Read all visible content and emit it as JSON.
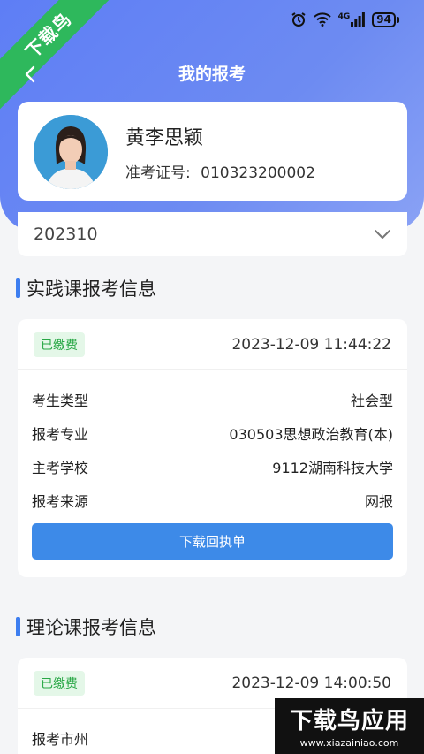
{
  "status_bar": {
    "battery": "94",
    "network": "4G"
  },
  "ribbon": {
    "text": "下载鸟"
  },
  "nav": {
    "title": "我的报考"
  },
  "profile": {
    "name": "黄李思颖",
    "ticket_label": "准考证号:",
    "ticket_number": "010323200002"
  },
  "term": {
    "selected": "202310"
  },
  "practice": {
    "title": "实践课报考信息",
    "badge": "已缴费",
    "time": "2023-12-09 11:44:22",
    "rows": [
      {
        "label": "考生类型",
        "value": "社会型"
      },
      {
        "label": "报考专业",
        "value": "030503思想政治教育(本)"
      },
      {
        "label": "主考学校",
        "value": "9112湖南科技大学"
      },
      {
        "label": "报考来源",
        "value": "网报"
      }
    ],
    "download_label": "下载回执单"
  },
  "theory": {
    "title": "理论课报考信息",
    "badge": "已缴费",
    "time": "2023-12-09 14:00:50",
    "rows": [
      {
        "label": "报考市州",
        "value": ""
      }
    ]
  },
  "watermark": {
    "title": "下载鸟应用",
    "url": "www.xiazainiao.com"
  }
}
